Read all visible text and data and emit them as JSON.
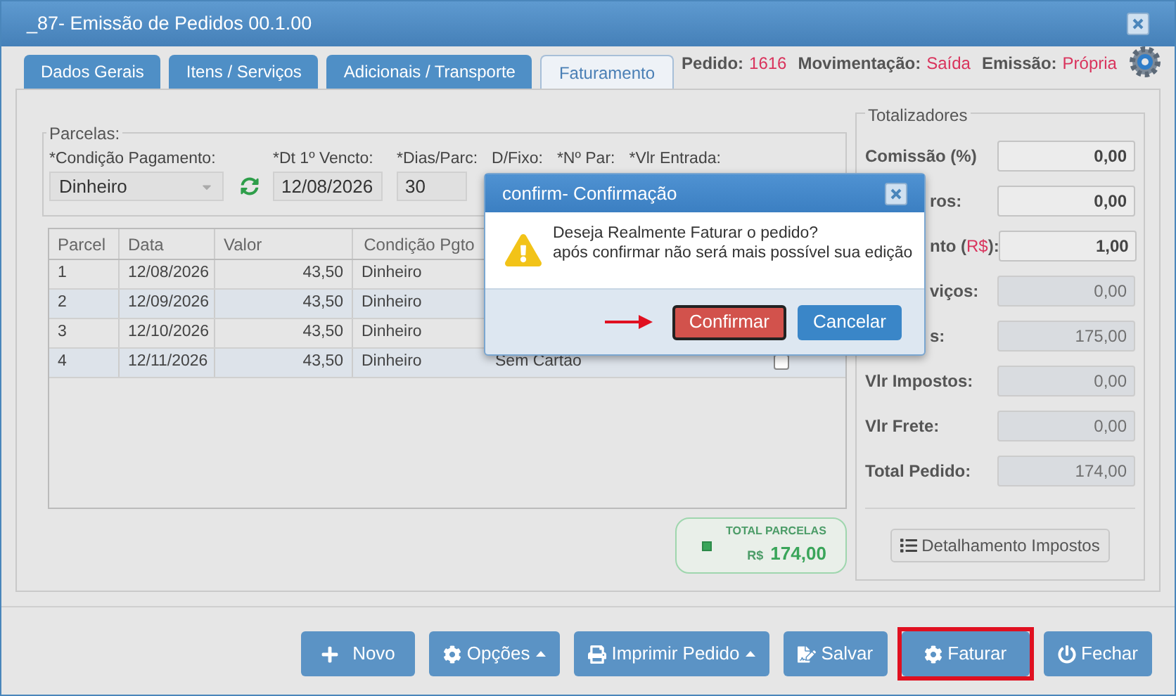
{
  "window": {
    "title": "_87- Emissão de Pedidos 00.1.00"
  },
  "tabs": [
    {
      "label": "Dados Gerais",
      "selected": false
    },
    {
      "label": "Itens / Serviços",
      "selected": false
    },
    {
      "label": "Adicionais / Transporte",
      "selected": false
    },
    {
      "label": "Faturamento",
      "selected": true
    }
  ],
  "header_info": [
    {
      "label": "Pedido:",
      "value": "1616"
    },
    {
      "label": "Movimentação:",
      "value": "Saída"
    },
    {
      "label": "Emissão:",
      "value": "Própria"
    }
  ],
  "parcelas": {
    "legend": "Parcelas:",
    "fields": [
      {
        "kind": "select",
        "label": "*Condição Pagamento:",
        "value": "Dinheiro"
      },
      {
        "kind": "input",
        "label": "*Dt 1º Vencto:",
        "value": "12/08/2026"
      },
      {
        "kind": "input",
        "label": "*Dias/Parc:",
        "value": "30"
      },
      {
        "kind": "covered",
        "label": "D/Fixo:"
      },
      {
        "kind": "covered",
        "label": "*Nº Par:"
      },
      {
        "kind": "covered",
        "label": "*Vlr Entrada:"
      }
    ]
  },
  "table": {
    "columns": [
      "Parcel",
      "Data",
      "Valor",
      "Condição Pgto"
    ],
    "rows": [
      {
        "cells": [
          "1",
          "12/08/2026",
          "43,50",
          "Dinheiro"
        ]
      },
      {
        "cells": [
          "2",
          "12/09/2026",
          "43,50",
          "Dinheiro"
        ]
      },
      {
        "cells": [
          "3",
          "12/10/2026",
          "43,50",
          "Dinheiro"
        ]
      },
      {
        "cells": [
          "4",
          "12/11/2026",
          "43,50",
          "Dinheiro",
          "Sem Cartão"
        ],
        "checked": false
      }
    ]
  },
  "total_parcelas": {
    "label": "TOTAL PARCELAS",
    "currency": "R$",
    "value": "174,00"
  },
  "totalizadores": {
    "legend": "Totalizadores",
    "rows": [
      {
        "label": "Comissão (%)",
        "value": "0,00",
        "disabled": false,
        "covered": false
      },
      {
        "label": "ros:",
        "value": "0,00",
        "disabled": false,
        "covered": true
      },
      {
        "label": "nto (",
        "unit": "R$",
        "label_end": "):",
        "value": "1,00",
        "disabled": false,
        "covered": true
      },
      {
        "label": "viços:",
        "value": "0,00",
        "disabled": true,
        "covered": true
      },
      {
        "label": "s:",
        "value": "175,00",
        "disabled": true,
        "covered": true
      },
      {
        "label": "Vlr Impostos:",
        "value": "0,00",
        "disabled": true,
        "covered": false
      },
      {
        "label": "Vlr Frete:",
        "value": "0,00",
        "disabled": true,
        "covered": false
      },
      {
        "label": "Total Pedido:",
        "value": "174,00",
        "disabled": true,
        "covered": false
      }
    ],
    "button": "Detalhamento Impostos"
  },
  "dialog": {
    "title": "confirm- Confirmação",
    "message": [
      "Deseja Realmente Faturar o pedido?",
      "após confirmar não será mais possível sua edição"
    ],
    "buttons": [
      {
        "label": "Confirmar",
        "kind": "danger",
        "focused": true
      },
      {
        "label": "Cancelar",
        "kind": "primary",
        "focused": false
      }
    ]
  },
  "footer_buttons": [
    {
      "label": "Novo",
      "kind": "new",
      "caret": false,
      "highlighted": false
    },
    {
      "label": "Opções",
      "kind": "options",
      "caret": true,
      "highlighted": false
    },
    {
      "label": "Imprimir Pedido",
      "kind": "print",
      "caret": true,
      "highlighted": false
    },
    {
      "label": "Salvar",
      "kind": "save",
      "caret": false,
      "highlighted": false
    },
    {
      "label": "Faturar",
      "kind": "invoice",
      "caret": false,
      "highlighted": true
    },
    {
      "label": "Fechar",
      "kind": "close",
      "caret": false,
      "highlighted": false
    }
  ]
}
